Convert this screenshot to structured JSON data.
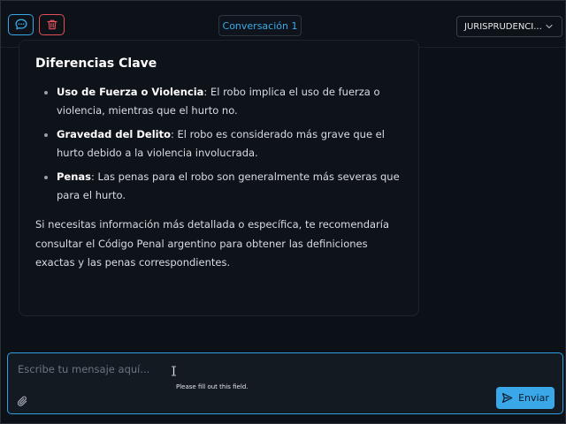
{
  "header": {
    "conversation_title": "Conversación 1",
    "category_select": "JURISPRUDENCI...",
    "icons": [
      "chat-icon",
      "trash-icon",
      "chevron-down-icon"
    ]
  },
  "message": {
    "heading": "Diferencias Clave",
    "items": [
      {
        "term": "Uso de Fuerza o Violencia",
        "text": ": El robo implica el uso de fuerza o violencia, mientras que el hurto no."
      },
      {
        "term": "Gravedad del Delito",
        "text": ": El robo es considerado más grave que el hurto debido a la violencia involucrada."
      },
      {
        "term": "Penas",
        "text": ": Las penas para el robo son generalmente más severas que para el hurto."
      }
    ],
    "closing": "Si necesitas información más detallada o específica, te recomendaría consultar el Código Penal argentino para obtener las definiciones exactas y las penas correspondientes."
  },
  "composer": {
    "placeholder": "Escribe tu mensaje aquí...",
    "validation_tooltip": "Please fill out this field.",
    "send_label": "Enviar",
    "icons": [
      "paperclip-icon",
      "send-icon",
      "text-cursor-icon"
    ]
  },
  "colors": {
    "accent": "#3aa7e8",
    "danger": "#e0505a",
    "background": "#0c1017"
  }
}
